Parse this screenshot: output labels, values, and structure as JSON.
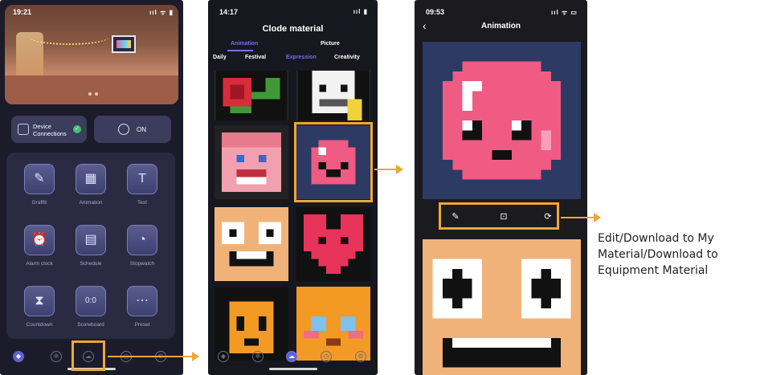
{
  "colors": {
    "highlight": "#f0a733",
    "accent_purple": "#7a6fe0",
    "connected_green": "#3ec26b"
  },
  "phone1": {
    "time": "19:21",
    "status_icons": "ııl ᯤ ▮",
    "device_button": "Device Connections",
    "on_button": "ON",
    "tiles": [
      {
        "label": "Graffiti",
        "icon": "graffiti-icon",
        "glyph": "✎"
      },
      {
        "label": "Animation",
        "icon": "animation-icon",
        "glyph": "▦"
      },
      {
        "label": "Text",
        "icon": "text-icon",
        "glyph": "T"
      },
      {
        "label": "Alarm clock",
        "icon": "alarm-clock-icon",
        "glyph": "⏰"
      },
      {
        "label": "Schedule",
        "icon": "schedule-icon",
        "glyph": "▤"
      },
      {
        "label": "Stopwatch",
        "icon": "stopwatch-icon",
        "glyph": "◔"
      },
      {
        "label": "Countdown",
        "icon": "hourglass-icon",
        "glyph": "⧗"
      },
      {
        "label": "Scoreboard",
        "icon": "scoreboard-icon",
        "glyph": "0:0"
      },
      {
        "label": "Preset",
        "icon": "preset-icon",
        "glyph": "⋯"
      }
    ],
    "tab_icons": [
      "compass-icon",
      "gear-wheel-icon",
      "cloud-material-icon",
      "timer-icon",
      "settings-icon"
    ]
  },
  "phone2": {
    "time": "14:17",
    "status_icons": "ııl ▮",
    "title": "Clode material",
    "tabs": [
      "Animation",
      "Picture"
    ],
    "categories": [
      "Daily",
      "Festival",
      "Expression",
      "Creativity"
    ],
    "active_category": "Expression",
    "thumbnails": [
      "rose",
      "skull",
      "pink-face",
      "pink-blob",
      "orange-face",
      "red-heart",
      "orange-owl",
      "orange-cat"
    ]
  },
  "phone3": {
    "time": "09:53",
    "status_icons": "ııl ᯤ ▭",
    "title": "Animation",
    "back_icon": "‹",
    "tools": [
      {
        "name": "edit-icon",
        "glyph": "✎"
      },
      {
        "name": "download-my-material-icon",
        "glyph": "⊡"
      },
      {
        "name": "download-equipment-icon",
        "glyph": "⟳"
      }
    ]
  },
  "caption": "Edit/Download to My Material/Download to Equipment Material"
}
